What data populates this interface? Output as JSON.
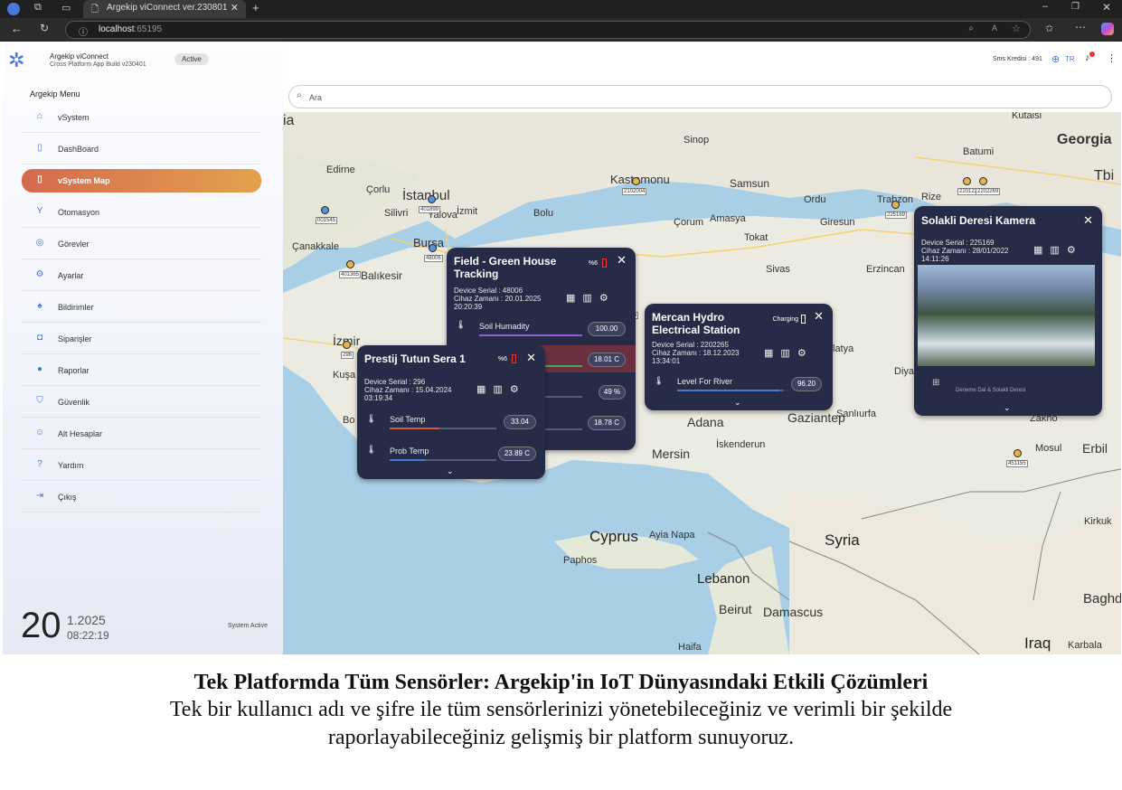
{
  "browser": {
    "tab_title": "Argekip viConnect ver.230801",
    "url_host": "localhost",
    "url_port": ":65195"
  },
  "app": {
    "name": "Argekip viConnect",
    "subtitle": "Cross Platform App Build v230401",
    "status_badge": "Active",
    "credit": "Sms Kredisi : 491",
    "language": "TR"
  },
  "sidebar": {
    "heading": "Argekip Menu",
    "items": [
      {
        "label": "vSystem",
        "icon": "home-icon"
      },
      {
        "label": "DashBoard",
        "icon": "dashboard-icon"
      },
      {
        "label": "vSystem Map",
        "icon": "map-icon",
        "active": true
      },
      {
        "label": "Otomasyon",
        "icon": "automation-icon"
      },
      {
        "label": "Görevler",
        "icon": "tasks-icon"
      },
      {
        "label": "Ayarlar",
        "icon": "gear-icon"
      },
      {
        "label": "Bildirimler",
        "icon": "bell-icon"
      },
      {
        "label": "Siparişler",
        "icon": "bag-icon"
      },
      {
        "label": "Raporlar",
        "icon": "info-icon"
      },
      {
        "label": "Güvenlik",
        "icon": "shield-icon"
      },
      {
        "label": "Alt Hesaplar",
        "icon": "users-icon"
      },
      {
        "label": "Yardım",
        "icon": "help-icon"
      },
      {
        "label": "Çıkış",
        "icon": "logout-icon"
      }
    ],
    "clock_day": "20",
    "clock_date": "1.2025",
    "clock_time": "08:22:19",
    "system_status": "System Active"
  },
  "search": {
    "placeholder": "Ara"
  },
  "map": {
    "labels": [
      "Georgia",
      "Kutaisi",
      "Batumi",
      "Sinop",
      "Kastamonu",
      "Samsun",
      "Ordu",
      "Trabzon",
      "Rize",
      "Tbi",
      "Edirne",
      "Çorlu",
      "İstanbul",
      "İzmit",
      "Silivri",
      "Yalova",
      "Bolu",
      "Çorum",
      "Amasya",
      "Tokat",
      "Giresun",
      "Çanakkale",
      "Bursa",
      "Balıkesir",
      "Sivas",
      "Erzincan",
      "İzmir",
      "Kuşa",
      "Bo",
      "Adana",
      "Gaziantep",
      "Şanlıurfa",
      "Mersin",
      "İskenderun",
      "Diya",
      "Zakho",
      "Mosul",
      "Erbil",
      "Cyprus",
      "Ayia Napa",
      "Paphos",
      "Syria",
      "Lebanon",
      "Beirut",
      "Damascus",
      "Haifa",
      "Iraq",
      "Karbala",
      "Kirkuk",
      "Baghda",
      "latya",
      "ia"
    ],
    "pin_tags": [
      "001545",
      "401365",
      "48006",
      "2102004",
      "2202265",
      "225169",
      "2201222",
      "2202269",
      "296",
      "451155",
      "401899"
    ]
  },
  "cards": {
    "greenhouse": {
      "title": "Field - Green House Tracking",
      "battery": "%6",
      "serial": "Device Serial : 48006",
      "time": "Cihaz Zamanı : 20.01.2025 20:20:39",
      "rows": [
        {
          "label": "Soil Humadity",
          "value": "100.00"
        },
        {
          "label": "",
          "value": "18.01 C"
        },
        {
          "label": "",
          "value": "49 %"
        },
        {
          "label": "",
          "value": "18.78 C"
        }
      ]
    },
    "mercan": {
      "title": "Mercan Hydro Electrical Station",
      "battery": "Charging",
      "serial": "Device Serial : 2202265",
      "time": "Cihaz Zamanı : 18.12.2023 13:34:01",
      "rows": [
        {
          "label": "Level For River",
          "value": "96.20"
        }
      ]
    },
    "prestij": {
      "title": "Prestij Tutun Sera 1",
      "battery": "%6",
      "serial": "Device Serial : 296",
      "time": "Cihaz Zamanı : 15.04.2024 03:19:34",
      "rows": [
        {
          "label": "Soil Temp",
          "value": "33.04"
        },
        {
          "label": "Prob Temp",
          "value": "23.89 C"
        }
      ]
    },
    "camera": {
      "title": "Solakli Deresi Kamera",
      "serial": "Device Serial : 225169",
      "time": "Cihaz Zamanı : 28/01/2022 14:11:26",
      "footer": "Deneme Dal & Solakli Deresi"
    }
  },
  "caption": {
    "title": "Tek Platformda Tüm Sensörler: Argekip'in IoT Dünyasındaki Etkili Çözümleri",
    "line1": "Tek bir kullanıcı adı ve şifre ile tüm sensörlerinizi yönetebileceğiniz ve verimli bir şekilde",
    "line2": "raporlayabileceğiniz gelişmiş bir platform sunuyoruz."
  }
}
